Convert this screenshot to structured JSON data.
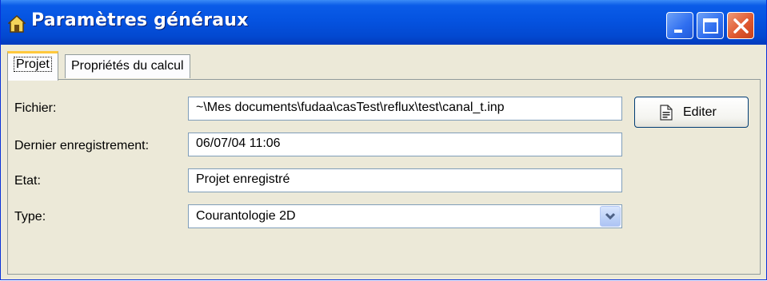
{
  "window": {
    "title": "Paramètres  généraux",
    "icon": "home-icon"
  },
  "tabs": [
    {
      "label": "Projet",
      "active": true
    },
    {
      "label": "Propriétés du calcul",
      "active": false
    }
  ],
  "form": {
    "fichier": {
      "label": "Fichier:",
      "value": "~\\Mes documents\\fudaa\\casTest\\reflux\\test\\canal_t.inp"
    },
    "dernier": {
      "label": "Dernier enregistrement:",
      "value": "06/07/04 11:06"
    },
    "etat": {
      "label": "Etat:",
      "value": "Projet enregistré"
    },
    "type": {
      "label": "Type:",
      "value": "Courantologie 2D"
    }
  },
  "buttons": {
    "edit_label": "Editer"
  },
  "colors": {
    "titlebar": "#0553e0",
    "close": "#e05a31",
    "active_tab_marker": "#ffc83c",
    "face": "#ece9d8"
  }
}
